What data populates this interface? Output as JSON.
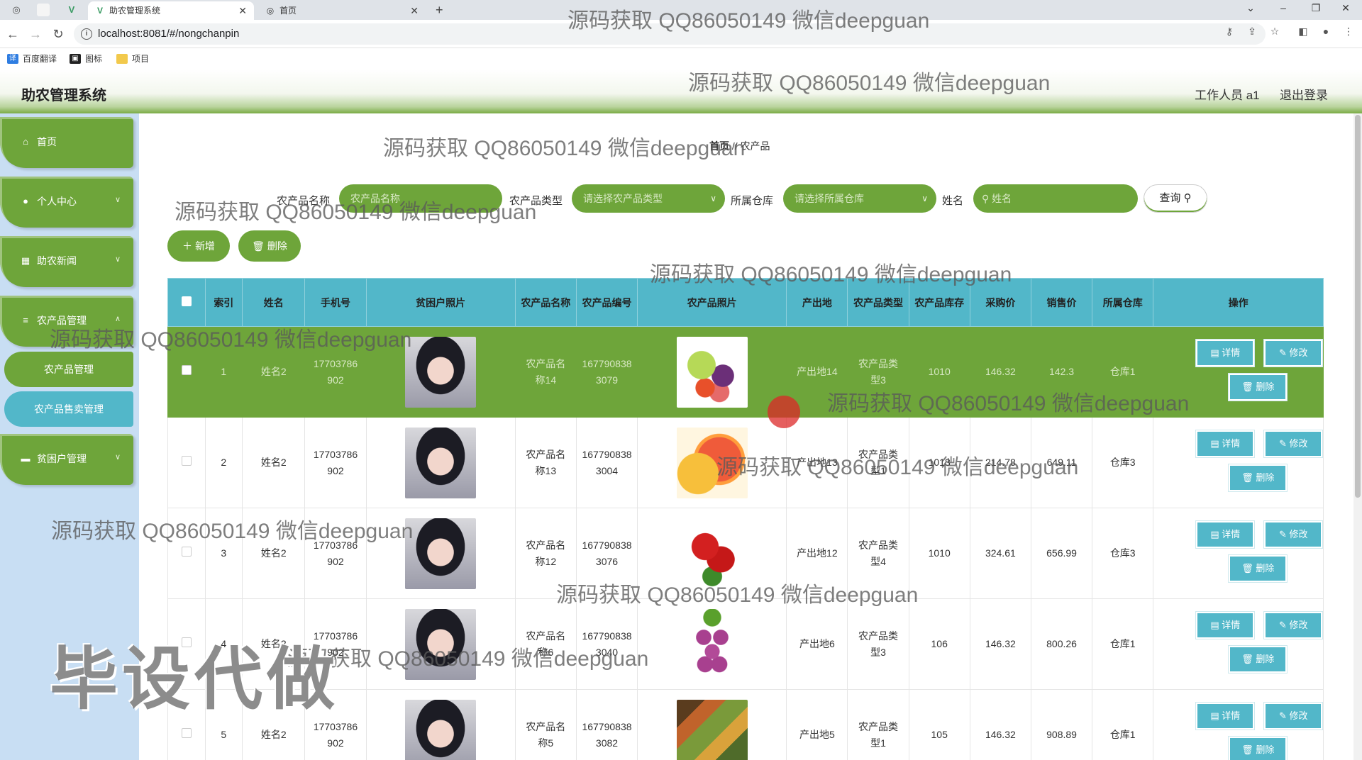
{
  "browser": {
    "tabs": [
      {
        "title": "助农管理系统",
        "active": true
      },
      {
        "title": "首页",
        "active": false
      }
    ],
    "url": "localhost:8081/#/nongchanpin",
    "bookmarks": [
      "百度翻译",
      "图标",
      "项目"
    ]
  },
  "header": {
    "title": "助农管理系统",
    "user": "工作人员 a1",
    "logout": "退出登录"
  },
  "sidebar": {
    "items": [
      {
        "label": "首页",
        "icon": "home-icon"
      },
      {
        "label": "个人中心",
        "icon": "user-icon"
      },
      {
        "label": "助农新闻",
        "icon": "grid-icon"
      },
      {
        "label": "农产品管理",
        "icon": "list-icon"
      },
      {
        "label": "贫困户管理",
        "icon": "monitor-icon"
      }
    ],
    "sub_items": [
      "农产品管理",
      "农产品售卖管理"
    ]
  },
  "breadcrumb": {
    "home": "首页",
    "sep": "//",
    "current": "农产品"
  },
  "search": {
    "name_label": "农产品名称",
    "name_placeholder": "农产品名称",
    "type_label": "农产品类型",
    "type_placeholder": "请选择农产品类型",
    "warehouse_label": "所属仓库",
    "warehouse_placeholder": "请选择所属仓库",
    "person_label": "姓名",
    "person_placeholder": "姓名",
    "query_button": "查询"
  },
  "actions": {
    "add": "新增",
    "delete": "删除"
  },
  "table": {
    "headers": [
      "索引",
      "姓名",
      "手机号",
      "贫困户照片",
      "农产品名称",
      "农产品编号",
      "农产品照片",
      "产出地",
      "农产品类型",
      "农产品库存",
      "采购价",
      "销售价",
      "所属仓库",
      "操作"
    ],
    "row_buttons": {
      "detail": "详情",
      "edit": "修改",
      "delete": "删除"
    },
    "rows": [
      {
        "index": "1",
        "name": "姓名2",
        "phone": "17703786902",
        "product": "农产品名称14",
        "code": "1677908383079",
        "origin": "产出地14",
        "type": "农产品类型3",
        "stock": "1010",
        "buy": "146.32",
        "sell": "142.3",
        "warehouse": "仓库1",
        "selected": true
      },
      {
        "index": "2",
        "name": "姓名2",
        "phone": "17703786902",
        "product": "农产品名称13",
        "code": "1677908383004",
        "origin": "产出地13",
        "type": "农产品类型1",
        "stock": "1013",
        "buy": "214.78",
        "sell": "649.11",
        "warehouse": "仓库3",
        "selected": false
      },
      {
        "index": "3",
        "name": "姓名2",
        "phone": "17703786902",
        "product": "农产品名称12",
        "code": "1677908383076",
        "origin": "产出地12",
        "type": "农产品类型4",
        "stock": "1010",
        "buy": "324.61",
        "sell": "656.99",
        "warehouse": "仓库3",
        "selected": false
      },
      {
        "index": "4",
        "name": "姓名2",
        "phone": "17703786902",
        "product": "农产品名称6",
        "code": "1677908383040",
        "origin": "产出地6",
        "type": "农产品类型3",
        "stock": "106",
        "buy": "146.32",
        "sell": "800.26",
        "warehouse": "仓库1",
        "selected": false
      },
      {
        "index": "5",
        "name": "姓名2",
        "phone": "17703786902",
        "product": "农产品名称5",
        "code": "1677908383082",
        "origin": "产出地5",
        "type": "农产品类型1",
        "stock": "105",
        "buy": "146.32",
        "sell": "908.89",
        "warehouse": "仓库1",
        "selected": false
      }
    ]
  },
  "watermarks": {
    "text": "源码获取 QQ86050149 微信deepguan",
    "big": "毕设代做"
  },
  "colors": {
    "accent_green": "#6ea53a",
    "table_header": "#52b7c9",
    "sidebar_bg": "#c8def3"
  }
}
